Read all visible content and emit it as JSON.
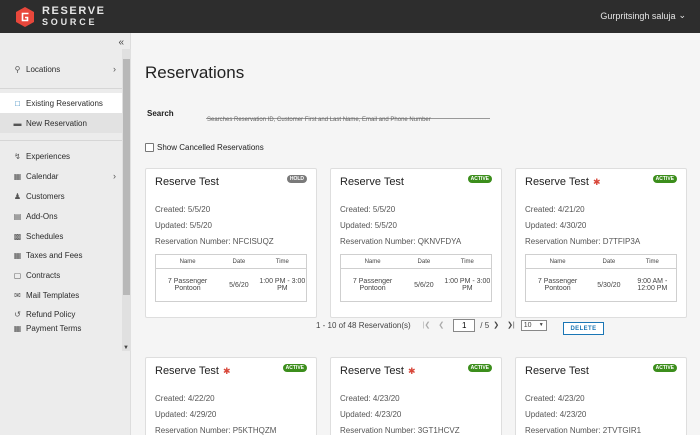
{
  "header": {
    "logo_line1": "RESERVE",
    "logo_line2": "SOURCE",
    "user_name": "Gurpritsingh saluja",
    "brand_color": "#e8473b"
  },
  "sidebar": {
    "items": [
      {
        "label": "Locations",
        "icon": "location-pin-icon",
        "has_chevron": true
      },
      {
        "label": "Existing Reservations",
        "icon": "document-icon",
        "active": true
      },
      {
        "label": "New Reservation",
        "icon": "card-icon"
      },
      {
        "label": "Experiences",
        "icon": "lightning-icon"
      },
      {
        "label": "Calendar",
        "icon": "calendar-icon",
        "has_chevron": true
      },
      {
        "label": "Customers",
        "icon": "people-icon"
      },
      {
        "label": "Add-Ons",
        "icon": "cart-icon"
      },
      {
        "label": "Schedules",
        "icon": "schedule-icon"
      },
      {
        "label": "Taxes and Fees",
        "icon": "tax-icon"
      },
      {
        "label": "Contracts",
        "icon": "contract-icon"
      },
      {
        "label": "Mail Templates",
        "icon": "mail-icon"
      },
      {
        "label": "Refund Policy",
        "icon": "refund-icon"
      },
      {
        "label": "Payment Terms",
        "icon": "terms-icon"
      }
    ]
  },
  "main": {
    "title": "Reservations",
    "search": {
      "label": "Search",
      "value": "",
      "hint": "Searches Reservation ID, Customer First and Last Name, Email and Phone Number"
    },
    "show_cancelled": {
      "label": "Show Cancelled Reservations",
      "checked": false
    },
    "table_headers": [
      "Name",
      "Date",
      "Time"
    ],
    "cards": [
      {
        "title": "Reserve Test",
        "status": "HOLD",
        "starred": false,
        "created": "Created: 5/5/20",
        "updated": "Updated: 5/5/20",
        "number": "Reservation Number: NFCISUQZ",
        "rows": [
          {
            "name": "7 Passenger Pontoon",
            "date": "5/6/20",
            "time": "1:00 PM - 3:00 PM"
          }
        ]
      },
      {
        "title": "Reserve Test",
        "status": "ACTIVE",
        "starred": false,
        "created": "Created: 5/5/20",
        "updated": "Updated: 5/5/20",
        "number": "Reservation Number: QKNVFDYA",
        "rows": [
          {
            "name": "7 Passenger Pontoon",
            "date": "5/6/20",
            "time": "1:00 PM - 3:00 PM"
          }
        ]
      },
      {
        "title": "Reserve Test",
        "status": "ACTIVE",
        "starred": true,
        "created": "Created: 4/21/20",
        "updated": "Updated: 4/30/20",
        "number": "Reservation Number: D7TFIP3A",
        "rows": [
          {
            "name": "7 Passenger Pontoon",
            "date": "5/30/20",
            "time": "9:00 AM - 12:00 PM"
          }
        ]
      },
      {
        "title": "Reserve Test",
        "status": "ACTIVE",
        "starred": true,
        "created": "Created: 4/22/20",
        "updated": "Updated: 4/29/20",
        "number": "Reservation Number: P5KTHQZM"
      },
      {
        "title": "Reserve Test",
        "status": "ACTIVE",
        "starred": true,
        "created": "Created: 4/23/20",
        "updated": "Updated: 4/23/20",
        "number": "Reservation Number: 3GT1HCVZ"
      },
      {
        "title": "Reserve Test",
        "status": "ACTIVE",
        "starred": false,
        "created": "Created: 4/23/20",
        "updated": "Updated: 4/23/20",
        "number": "Reservation Number: 2TVTGIR1"
      }
    ],
    "pagination": {
      "range_text": "1 - 10 of 48 Reservation(s)",
      "current_page": "1",
      "total_pages": "/ 5",
      "per_page": "10"
    },
    "delete_label": "DELETE"
  }
}
